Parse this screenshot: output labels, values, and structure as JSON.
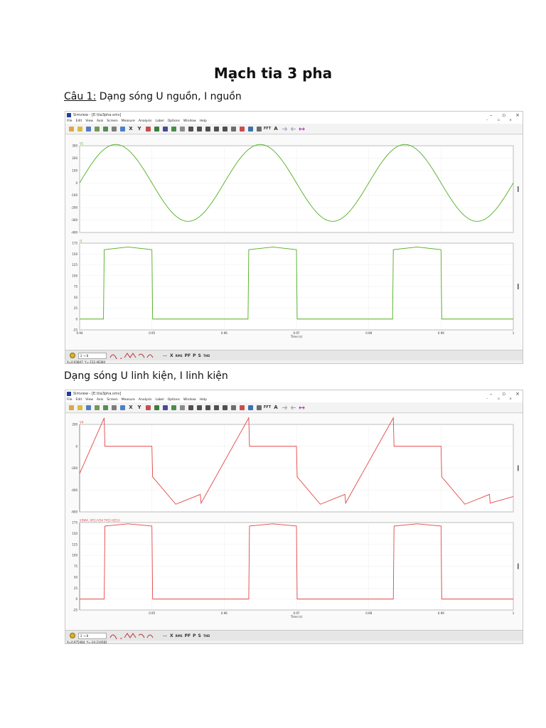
{
  "page": {
    "title": "Mạch tia 3 pha",
    "section1_prefix": "Câu 1:",
    "section1_text": " Dạng sóng U nguồn, I nguồn",
    "section2_text": "Dạng sóng U linh kiện, I linh kiện"
  },
  "app": {
    "window_title": "Simview - [E:\\tia3pha.smv]",
    "menu": [
      "File",
      "Edit",
      "View",
      "Axis",
      "Screen",
      "Measure",
      "Analysis",
      "Label",
      "Options",
      "Window",
      "Help"
    ],
    "mdi_controls": "– ▫ ×",
    "window_controls": [
      "–",
      "▫",
      "×"
    ],
    "toolbar_labels": {
      "x": "X",
      "y": "Y",
      "fft": "FFT",
      "a": "A"
    },
    "bottom_toolbar": {
      "combo": "2 → 8",
      "x_label": "X",
      "rms": "RMS",
      "pf": "PF",
      "p": "P",
      "s": "S",
      "thd": "THD"
    }
  },
  "screenshots": [
    {
      "status": "X=0.93847, Y=-152.46384",
      "plots": [
        {
          "label": "V1",
          "color": "#4fae1f",
          "y_ticks": [
            "300",
            "200",
            "100",
            "0",
            "-100",
            "-200",
            "-300",
            "-400"
          ],
          "ylim": [
            -400,
            300
          ]
        },
        {
          "label": "I1",
          "color": "#4fae1f",
          "y_ticks": [
            "175",
            "150",
            "125",
            "100",
            "75",
            "50",
            "25",
            "0",
            "-25"
          ],
          "ylim": [
            -25,
            175
          ]
        }
      ],
      "x_ticks": [
        "0.94",
        "0.95",
        "0.96",
        "0.97",
        "0.98",
        "0.99",
        "1"
      ],
      "x_axis_label": "Time (s)"
    },
    {
      "status": "X=0.975484, Y=-24.214582",
      "plots": [
        {
          "label": "V4",
          "color": "#e64545",
          "y_ticks": [
            "200",
            "0",
            "-200",
            "-400",
            "-600"
          ],
          "ylim": [
            -600,
            200
          ]
        },
        {
          "label": "I(SW4, I(R1) I(S4 TH1) I(D1))",
          "color": "#e64545",
          "y_ticks": [
            "175",
            "150",
            "125",
            "100",
            "75",
            "50",
            "25",
            "0",
            "-25"
          ],
          "ylim": [
            -25,
            175
          ]
        }
      ],
      "x_ticks": [
        "0.95",
        "0.96",
        "0.97",
        "0.98",
        "0.99",
        "1"
      ],
      "x_axis_label": "Time (s)"
    }
  ],
  "chart_data": [
    {
      "type": "line",
      "x": [
        0.94,
        0.9425,
        0.945,
        0.9475,
        0.95,
        0.9525,
        0.955,
        0.9575,
        0.96,
        0.9625,
        0.965,
        0.9675,
        0.97,
        0.9725,
        0.975,
        0.9775,
        0.98,
        0.9825,
        0.985,
        0.9875,
        0.99,
        0.9925,
        0.995,
        0.9975,
        1.0
      ],
      "series": [
        {
          "name": "V1",
          "values": [
            0,
            219,
            310,
            219,
            0,
            -219,
            -310,
            -219,
            0,
            219,
            310,
            219,
            0,
            -219,
            -310,
            -219,
            0,
            219,
            310,
            219,
            0,
            -219,
            -310,
            -219,
            0
          ]
        }
      ],
      "xlim": [
        0.94,
        1.0
      ],
      "ylim": [
        -400,
        300
      ],
      "ylabel": "",
      "xlabel": "Time (s)"
    },
    {
      "type": "line",
      "x": [
        0.94,
        0.9433,
        0.9434,
        0.9467,
        0.95,
        0.9501,
        0.9633,
        0.9634,
        0.9667,
        0.97,
        0.9701,
        0.9833,
        0.9834,
        0.9867,
        0.99,
        0.9901,
        1.0
      ],
      "series": [
        {
          "name": "I1",
          "values": [
            0,
            0,
            160,
            166,
            160,
            0,
            0,
            160,
            166,
            160,
            0,
            0,
            160,
            166,
            160,
            0,
            0
          ]
        }
      ],
      "xlim": [
        0.94,
        1.0
      ],
      "ylim": [
        -25,
        175
      ],
      "xlabel": "Time (s)"
    },
    {
      "type": "line",
      "x": [
        0.94,
        0.9434,
        0.9435,
        0.95,
        0.9501,
        0.9533,
        0.9567,
        0.9568,
        0.9634,
        0.9635,
        0.97,
        0.9701,
        0.9733,
        0.9767,
        0.9768,
        0.9834,
        0.9835,
        0.99,
        0.9901,
        0.9933,
        0.9967,
        0.9968,
        1.0
      ],
      "series": [
        {
          "name": "V4",
          "values": [
            -250,
            260,
            0,
            0,
            -280,
            -530,
            -440,
            -520,
            260,
            0,
            0,
            -280,
            -530,
            -440,
            -520,
            260,
            0,
            0,
            -280,
            -530,
            -440,
            -520,
            -460
          ]
        }
      ],
      "xlim": [
        0.94,
        1.0
      ],
      "ylim": [
        -600,
        200
      ],
      "xlabel": "Time (s)"
    },
    {
      "type": "line",
      "x": [
        0.94,
        0.9434,
        0.9435,
        0.9467,
        0.95,
        0.9501,
        0.9634,
        0.9635,
        0.9667,
        0.97,
        0.9701,
        0.9834,
        0.9835,
        0.9867,
        0.99,
        0.9901,
        1.0
      ],
      "series": [
        {
          "name": "I(SW4, I(R1) I(S4 TH1) I(D1))",
          "values": [
            0,
            0,
            167,
            172,
            167,
            0,
            0,
            167,
            172,
            167,
            0,
            0,
            167,
            172,
            167,
            0,
            0
          ]
        }
      ],
      "xlim": [
        0.94,
        1.0
      ],
      "ylim": [
        -25,
        175
      ],
      "xlabel": "Time (s)"
    }
  ]
}
